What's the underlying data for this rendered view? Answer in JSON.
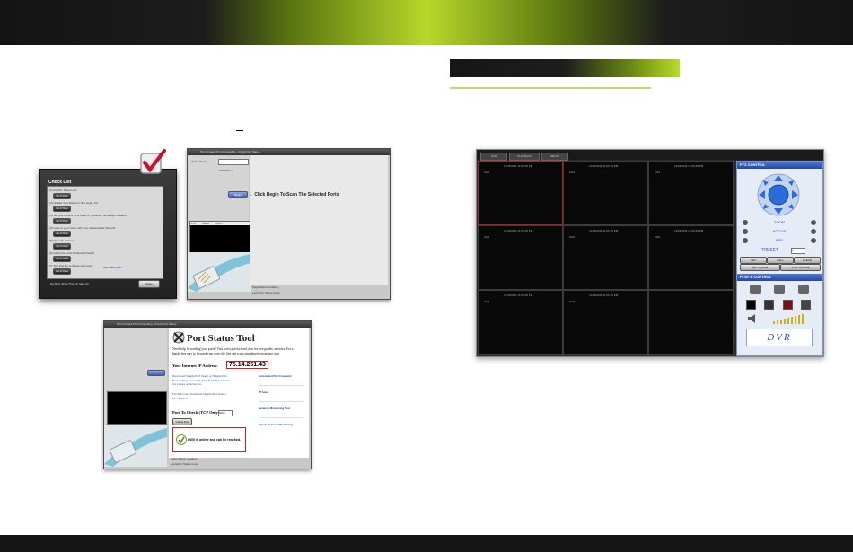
{
  "checklist": {
    "title": "Check List",
    "steps": [
      "(1) Confirm Router List",
      "(2) Update Your Router in Our Login, 1/3",
      "(3) Set your Local IP to a Static IP (Optional, not always needed)",
      "(4) Login to your router with your password for Network",
      "(5) Open the Router",
      "(6) Add ports to the Windows Firewall",
      "(7) Test that the ports are open work"
    ],
    "go_label": "Go It Now",
    "footer_note": "No More Show This On Start Up",
    "close_label": "Close",
    "help_note": "Still Need Help?"
  },
  "scan_window": {
    "title": "Port Forward Port Forwarding - Check Port Status",
    "ip_label": "IP To Check:",
    "ip_value": "192.168.0.1",
    "begin_label": "Begin",
    "callout": "Click Begin To Scan The Selected Ports",
    "status_label": "Page Status: Loading...",
    "status2": "Last Error Status Code:",
    "list_headers": [
      "Port",
      "Status",
      "Open?"
    ]
  },
  "port_window": {
    "title": "Port Forward Port Forwarding - Check Port Status",
    "heading": "Port Status Tool",
    "intro": "Need help forwarding your ports? Visit www.portforward.com for free guides, answers. For a hands-free way to forward your ports the free site www.simpleportforwarding.com",
    "ip_label": "Your Internet IP Address:",
    "ip_value": "75.14.251.43",
    "download": "Download Simple Port Tester or Simple Port Forwarding to test both TCP & UDP ports and for a more accurate test.",
    "mac": "For Mac User download Simple Port Tester - Mac Edition",
    "port_check_label": "Port To Check (TCP Only):",
    "port_value": "8000",
    "check_btn": "Check Port",
    "result": "8000 is online and can be reached.",
    "side_links": [
      "Automated Port Forwards",
      "IP Scan",
      "Network Monitoring Tool",
      "Attack Network Monitoring"
    ],
    "status_label": "Page Status: Loading...",
    "status2": "Last Error Status Code:"
  },
  "dvr": {
    "tabs": [
      "LIVE",
      "PLAYBACK",
      "SETUP"
    ],
    "timestamp": "11/22/2011 11:06:45 PM",
    "channels": [
      "CH1",
      "CH2",
      "CH3",
      "CH4",
      "CH5",
      "CH6",
      "CH7",
      "CH8",
      ""
    ],
    "ptz_title": "PTZ CONTROL",
    "zoom": "ZOOM",
    "focus": "FOCUS",
    "iris": "IRIS",
    "preset": "PRESET",
    "preset_value": "1",
    "buttons": [
      "SET",
      "CALL",
      "CLEAR",
      "SET CURISE",
      "STOP CRUISE"
    ],
    "play_title": "PLAY & CONTROL",
    "logo": "DVR"
  },
  "colors": {
    "accent": "#b7d72a",
    "dark": "#151515",
    "highlight": "#d31c1c"
  }
}
